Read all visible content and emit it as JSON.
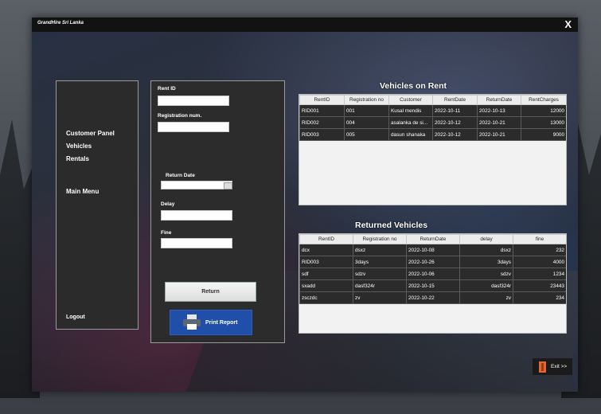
{
  "app_title": "GrandHire Sri Lanka",
  "close_label": "X",
  "nav": {
    "items": [
      "Customer Panel",
      "Vehicles",
      "Rentals"
    ],
    "main_menu": "Main Menu",
    "logout": "Logout"
  },
  "form": {
    "rent_id_label": "Rent ID",
    "reg_label": "Registration num.",
    "return_date_label": "Return Date",
    "delay_label": "Delay",
    "fine_label": "Fine",
    "return_button": "Return",
    "print_button": "Print Report"
  },
  "rent_table": {
    "title": "Vehicles on Rent",
    "columns": [
      "RentID",
      "Registration no",
      "Customer",
      "RentDate",
      "ReturnDate",
      "RentCharges"
    ],
    "rows": [
      [
        "RID001",
        "001",
        "Kusal mendis",
        "2022-10-11",
        "2022-10-13",
        "12000"
      ],
      [
        "RID002",
        "004",
        "asalanka de si...",
        "2022-10-12",
        "2022-10-21",
        "13000"
      ],
      [
        "RID003",
        "005",
        "dasun shanaka",
        "2022-10-12",
        "2022-10-21",
        "9000"
      ]
    ]
  },
  "returned_table": {
    "title": "Returned Vehicles",
    "columns": [
      "RentID",
      "Registration no",
      "ReturnDate",
      "delay",
      "fine"
    ],
    "rows": [
      [
        "dcx",
        "dsxz",
        "2022-10-08",
        "dsxz",
        "232"
      ],
      [
        "RID003",
        "3days",
        "2022-10-26",
        "3days",
        "4000"
      ],
      [
        "sdf",
        "sdzv",
        "2022-10-06",
        "sdzv",
        "1234"
      ],
      [
        "sxadd",
        "dasf324r",
        "2022-10-15",
        "dasf324r",
        "23443"
      ],
      [
        "zsczdc",
        "zv",
        "2022-10-22",
        "zv",
        "234"
      ]
    ]
  },
  "exit_label": "Exit >>",
  "colors": {
    "panel": "#2b2b2b",
    "print_button": "#1f4fa8",
    "exit_icon": "#e5672a"
  }
}
